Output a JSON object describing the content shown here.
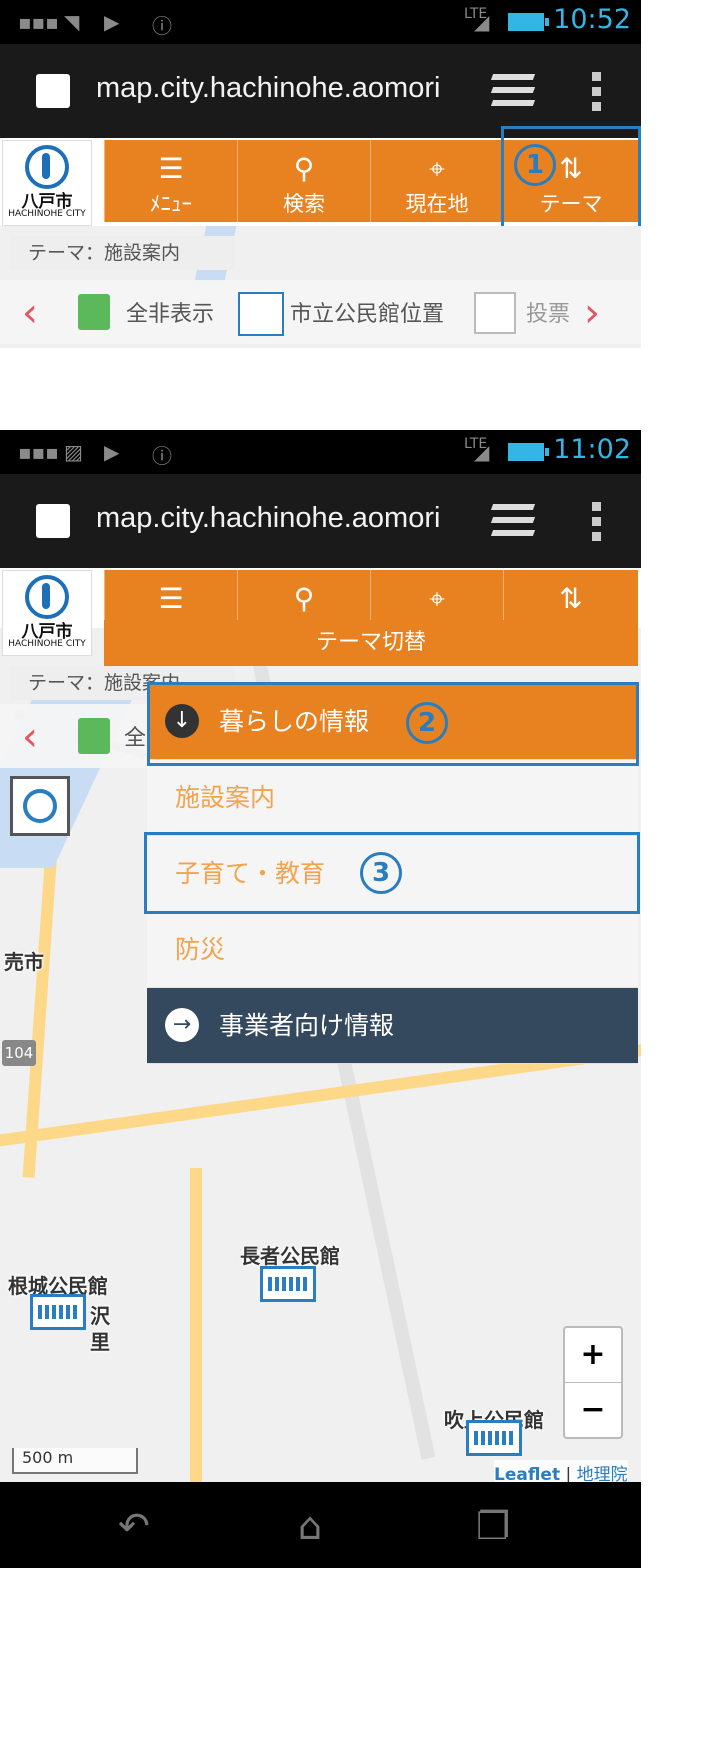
{
  "screen1": {
    "status": {
      "time": "10:52",
      "network": "LTE"
    },
    "browser": {
      "url": "map.city.hachinohe.aomori"
    },
    "logo": {
      "city_ja": "八戸市",
      "city_en": "HACHINOHE CITY"
    },
    "nav": [
      {
        "label": "ﾒﾆｭｰ",
        "icon": "list-icon"
      },
      {
        "label": "検索",
        "icon": "search-icon"
      },
      {
        "label": "現在地",
        "icon": "location-icon"
      },
      {
        "label": "テーマ",
        "icon": "switch-icon"
      }
    ],
    "theme_tag": "テーマ：施設案内",
    "strip": [
      "全非表示",
      "市立公民館位置",
      "投票"
    ],
    "badge": "1"
  },
  "screen2": {
    "status": {
      "time": "11:02",
      "network": "LTE"
    },
    "browser": {
      "url": "map.city.hachinohe.aomori"
    },
    "logo": {
      "city_ja": "八戸市",
      "city_en": "HACHINOHE CITY"
    },
    "dropdown": {
      "title": "テーマ切替",
      "header": "暮らしの情報",
      "items": [
        "施設案内",
        "子育て・教育",
        "防災"
      ],
      "business": "事業者向け情報"
    },
    "theme_tag": "テーマ：施設案内",
    "strip_first": "全",
    "badges": [
      "2",
      "3"
    ],
    "map_labels": {
      "city_fragment": "売市",
      "route": "104",
      "choja": "長者公民館",
      "nejo": "根城公民館",
      "sawasato_1": "沢",
      "sawasato_2": "里",
      "fukiage": "吹上公民館"
    },
    "scale": "500 m",
    "zoom": {
      "in": "+",
      "out": "−"
    },
    "attribution": {
      "leaflet": "Leaflet",
      "sep": "|",
      "gsi": "地理院"
    }
  },
  "colors": {
    "orange": "#e8811f",
    "callout_blue": "#2a7dbf",
    "dark": "#34495e",
    "status_blue": "#33b5e5"
  }
}
